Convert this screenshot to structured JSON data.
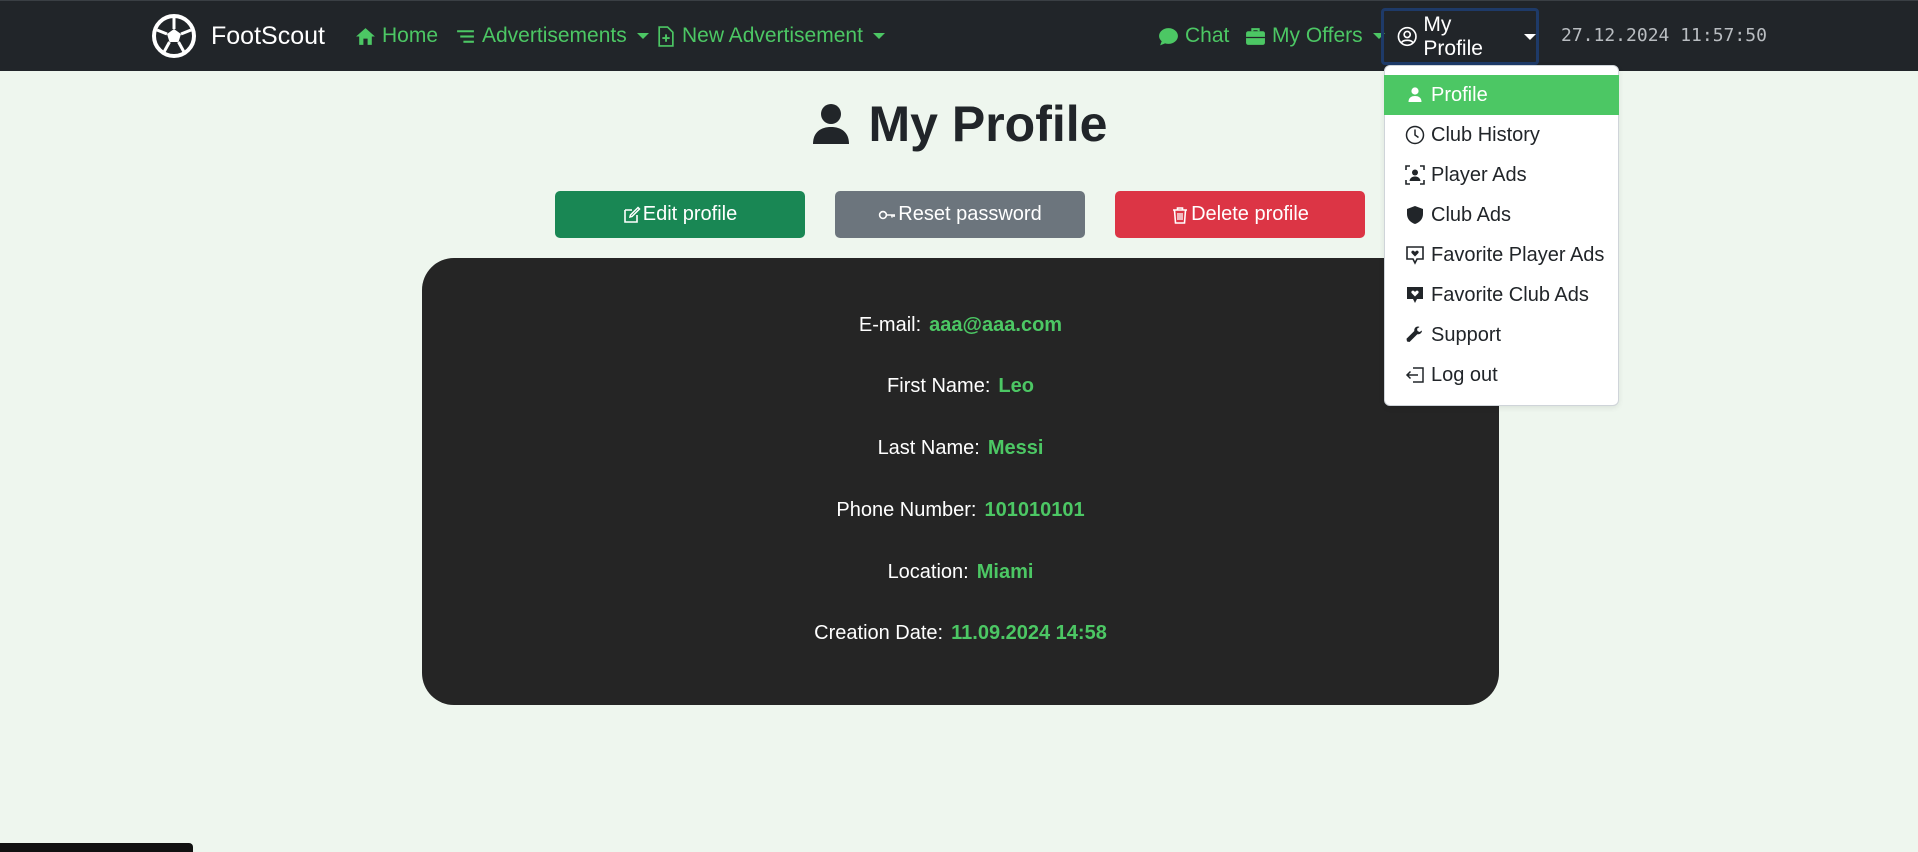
{
  "app": {
    "brand": "FootScout"
  },
  "nav": {
    "home": "Home",
    "advertisements": "Advertisements",
    "new_advertisement": "New Advertisement",
    "chat": "Chat",
    "my_offers": "My Offers",
    "my_profile": "My Profile",
    "datetime": "27.12.2024 11:57:50"
  },
  "profile_menu": {
    "items": [
      {
        "label": "Profile",
        "icon": "person-icon",
        "active": true
      },
      {
        "label": "Club History",
        "icon": "clock-icon"
      },
      {
        "label": "Player Ads",
        "icon": "person-badge-icon"
      },
      {
        "label": "Club Ads",
        "icon": "shield-icon"
      },
      {
        "label": "Favorite Player Ads",
        "icon": "chat-heart-icon"
      },
      {
        "label": "Favorite Club Ads",
        "icon": "chat-heart-fill-icon"
      },
      {
        "label": "Support",
        "icon": "wrench-icon"
      },
      {
        "label": "Log out",
        "icon": "logout-icon"
      }
    ]
  },
  "page": {
    "title": "My Profile",
    "buttons": {
      "edit": "Edit profile",
      "reset": "Reset password",
      "delete": "Delete profile"
    },
    "fields": [
      {
        "label": "E-mail:",
        "value": "aaa@aaa.com"
      },
      {
        "label": "First Name:",
        "value": "Leo"
      },
      {
        "label": "Last Name:",
        "value": "Messi"
      },
      {
        "label": "Phone Number:",
        "value": "101010101"
      },
      {
        "label": "Location:",
        "value": "Miami"
      },
      {
        "label": "Creation Date:",
        "value": "11.09.2024 14:58"
      }
    ]
  },
  "colors": {
    "accent": "#4cc764",
    "navbar": "#212529",
    "edit": "#198754",
    "reset": "#6c757d",
    "delete": "#dc3545",
    "card": "#252525",
    "background": "#eef6ee"
  }
}
